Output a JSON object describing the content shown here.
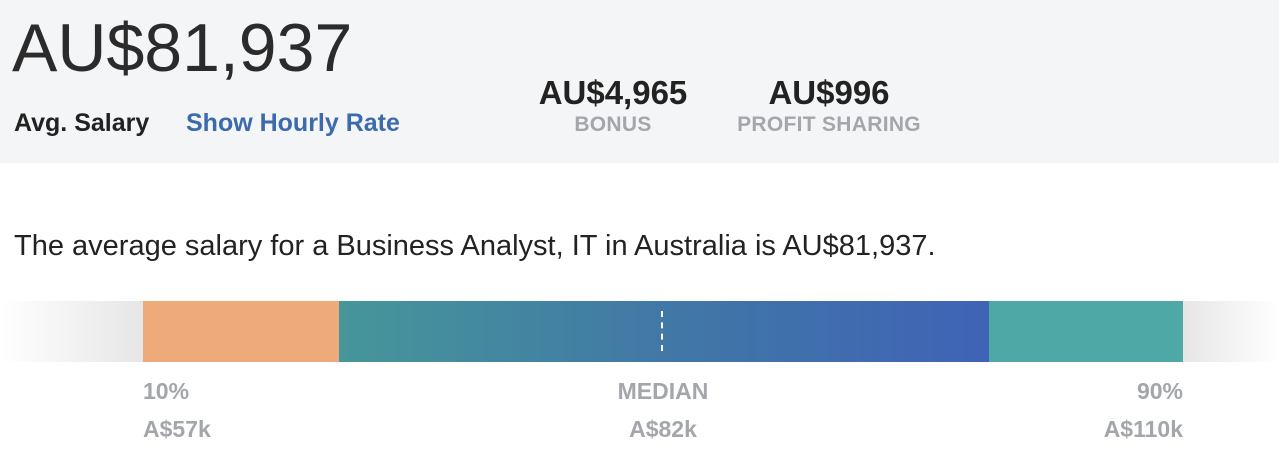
{
  "header": {
    "salary": "AU$81,937",
    "avg_label": "Avg. Salary",
    "hourly_link": "Show Hourly Rate",
    "bonus": {
      "value": "AU$4,965",
      "label": "BONUS"
    },
    "profit_sharing": {
      "value": "AU$996",
      "label": "PROFIT SHARING"
    }
  },
  "summary": "The average salary for a Business Analyst, IT in Australia is AU$81,937.",
  "distribution": {
    "colors": {
      "low": "#eeaa7a",
      "mid_start": "#46969a",
      "mid_end": "#3f63b6",
      "high": "#4ea8a5"
    },
    "p10": {
      "label": "10%",
      "value": "A$57k"
    },
    "median": {
      "label": "MEDIAN",
      "value": "A$82k"
    },
    "p90": {
      "label": "90%",
      "value": "A$110k"
    }
  }
}
